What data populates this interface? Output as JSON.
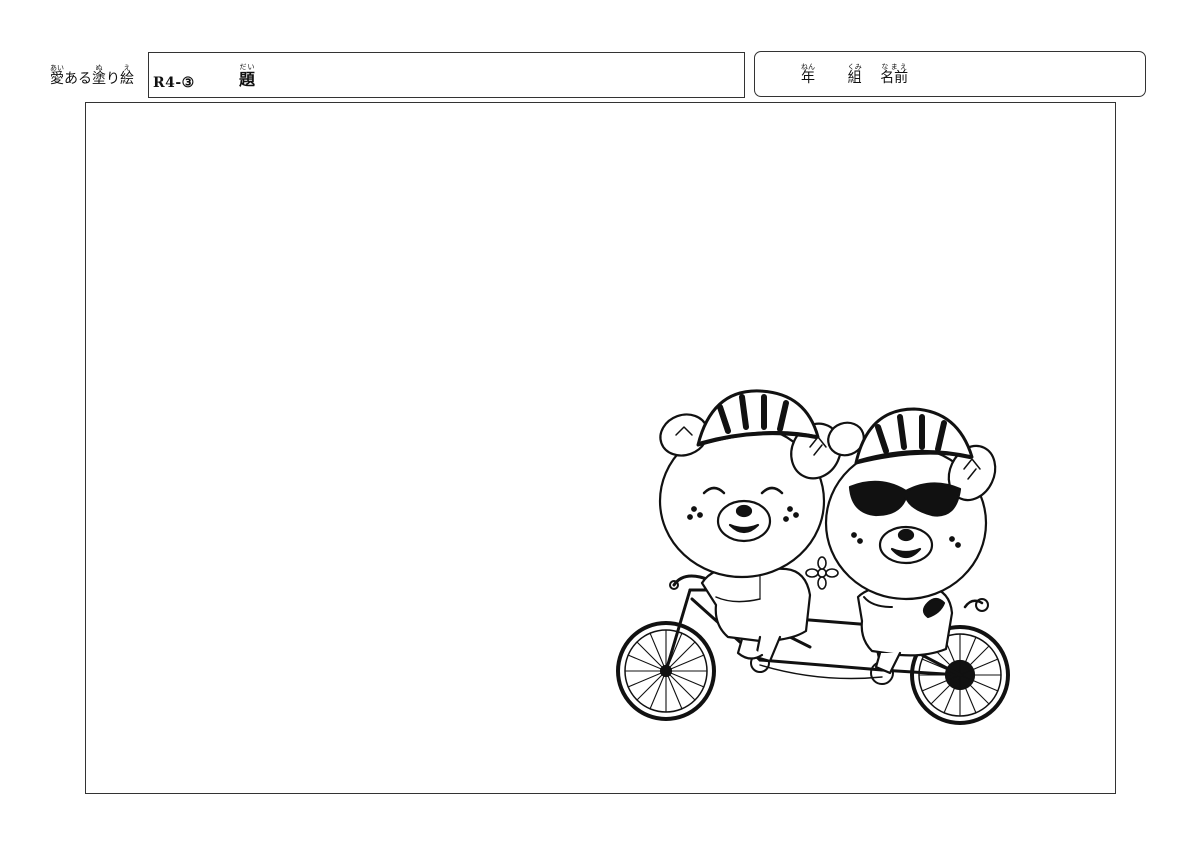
{
  "header": {
    "brand": {
      "parts": [
        {
          "text": "愛",
          "ruby": "あい"
        },
        {
          "text": "ある",
          "ruby": ""
        },
        {
          "text": "塗",
          "ruby": "ぬ"
        },
        {
          "text": "り",
          "ruby": ""
        },
        {
          "text": "絵",
          "ruby": "え"
        }
      ]
    },
    "title": {
      "code": "R4-③",
      "label": "題",
      "label_ruby": "だい"
    },
    "name_fields": {
      "year": {
        "text": "年",
        "ruby": "ねん"
      },
      "class": {
        "text": "組",
        "ruby": "くみ"
      },
      "name": {
        "text": "名前",
        "ruby": "なまえ"
      }
    }
  },
  "artwork": {
    "subject": "tandem-bicycle-bears-illustration"
  }
}
